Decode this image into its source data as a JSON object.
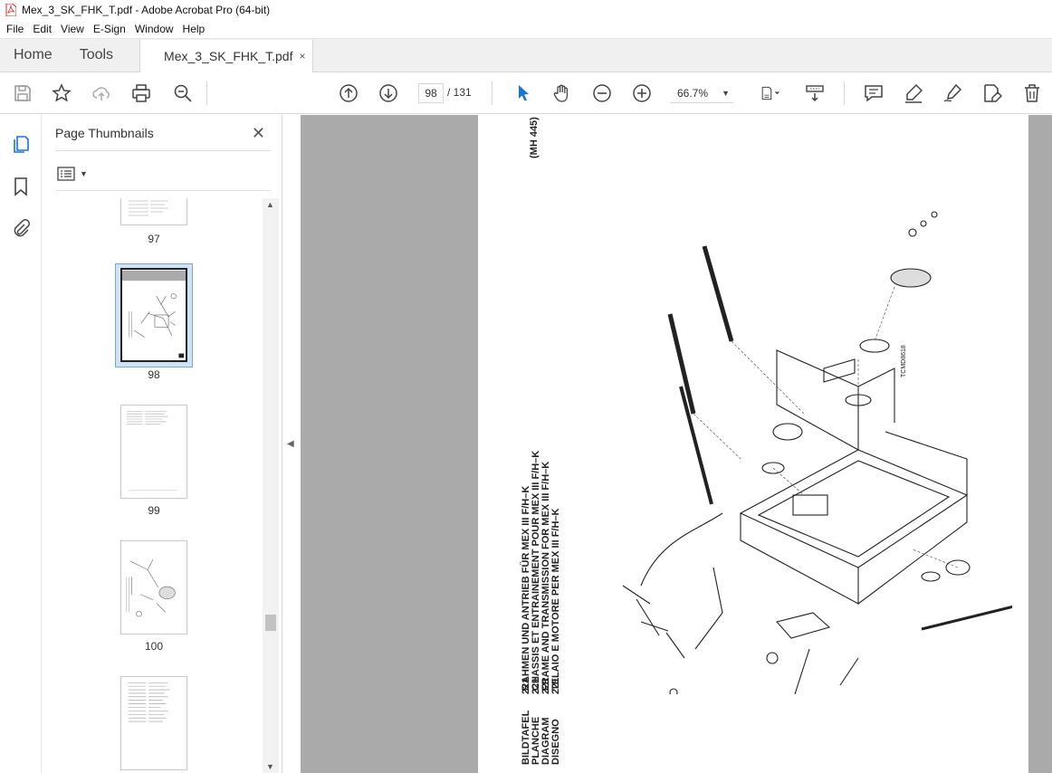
{
  "window": {
    "title": "Mex_3_SK_FHK_T.pdf - Adobe Acrobat Pro (64-bit)"
  },
  "menu": {
    "items": [
      "File",
      "Edit",
      "View",
      "E-Sign",
      "Window",
      "Help"
    ]
  },
  "tabs": {
    "home": "Home",
    "tools": "Tools",
    "document": "Mex_3_SK_FHK_T.pdf",
    "close": "×"
  },
  "toolbar": {
    "current_page": "98",
    "total_pages": "/ 131",
    "zoom": "66.7%",
    "icons": [
      "save-icon",
      "bookmark-star-icon",
      "upload-icon",
      "print-icon",
      "zoom-search-icon",
      "page-up-icon",
      "page-down-icon",
      "select-cursor-icon",
      "hand-icon",
      "zoom-out-icon",
      "zoom-in-icon",
      "page-fit-icon",
      "scroll-mode-icon",
      "comment-icon",
      "highlight-icon",
      "sign-icon",
      "edit-pdf-icon",
      "delete-icon"
    ]
  },
  "panel": {
    "title": "Page Thumbnails",
    "close": "✕",
    "thumbnails": [
      {
        "label": "97"
      },
      {
        "label": "98",
        "selected": true
      },
      {
        "label": "99"
      },
      {
        "label": "100"
      },
      {
        "label": ""
      }
    ]
  },
  "page": {
    "header_code": "(MH 445)",
    "drawing_ref": "TCMD8618",
    "titles": [
      "RAHMEN UND ANTRIEB FÜR MEX III F/H–K",
      "CHASSIS ET ENTRAINEMENT POUR MEX III F/H–K",
      "FRAME AND TRANSMISSION FOR MEX III F/H–K",
      "TELAIO E MOTORE PER MEX III F/H–K"
    ],
    "plate_numbers": [
      "221",
      "221",
      "221",
      "221"
    ],
    "plate_words": [
      "BILDTAFEL",
      "PLANCHE",
      "DIAGRAM",
      "DISEGNO"
    ]
  }
}
